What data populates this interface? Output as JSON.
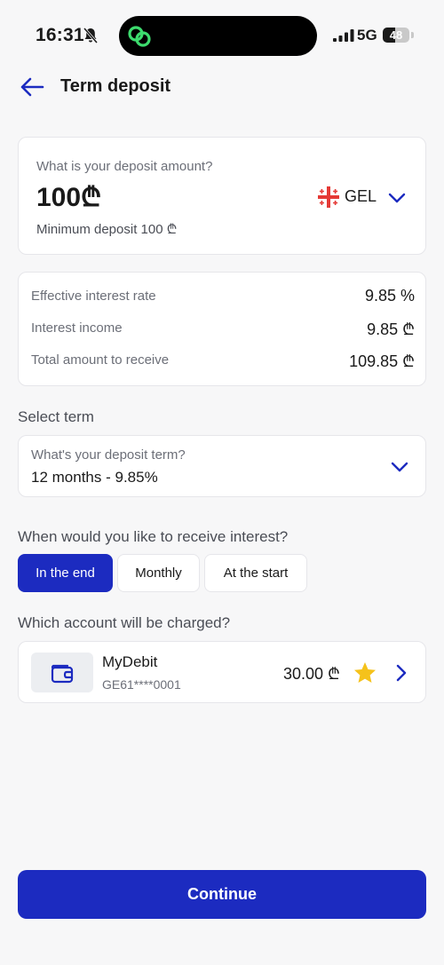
{
  "status_bar": {
    "time": "16:31",
    "network": "5G",
    "battery": "48",
    "battery_level": 0.48
  },
  "header": {
    "title": "Term deposit"
  },
  "amount": {
    "question": "What is your deposit amount?",
    "value": "100₾",
    "currency": "GEL",
    "minimum": "Minimum deposit 100 ₾"
  },
  "summary": {
    "rows": [
      {
        "label": "Effective interest rate",
        "value": "9.85 %"
      },
      {
        "label": "Interest income",
        "value": "9.85 ₾"
      },
      {
        "label": "Total amount to receive",
        "value": "109.85 ₾"
      }
    ]
  },
  "term": {
    "section_label": "Select term",
    "question": "What's your deposit term?",
    "value": "12 months - 9.85%"
  },
  "interest_timing": {
    "section_label": "When would you like to receive interest?",
    "options": [
      "In the end",
      "Monthly",
      "At the start"
    ],
    "selected": "In the end"
  },
  "account": {
    "section_label": "Which account will be charged?",
    "name": "MyDebit",
    "number": "GE61****0001",
    "balance": "30.00 ₾",
    "favorite": true
  },
  "continue_label": "Continue",
  "colors": {
    "primary": "#1c2bc0",
    "star": "#f5c21b",
    "flag_red": "#e53935"
  }
}
